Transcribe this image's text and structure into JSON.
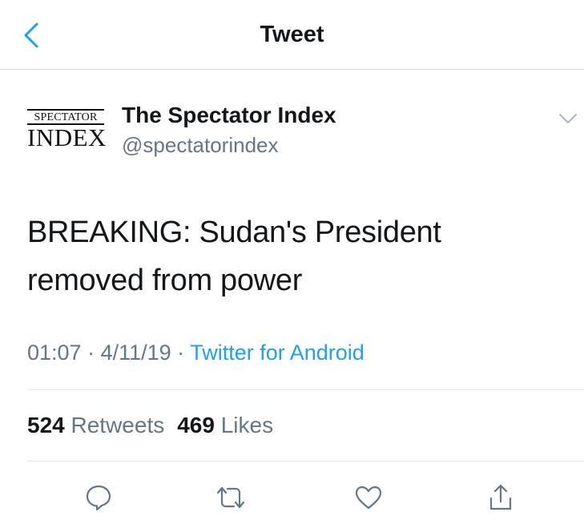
{
  "nav": {
    "title": "Tweet",
    "back_icon": "chevron-left-icon",
    "accent_color": "#1da1f2"
  },
  "author": {
    "logo_top": "SPECTATOR",
    "logo_bottom": "INDEX",
    "display_name": "The Spectator Index",
    "handle": "@spectatorindex",
    "menu_icon": "chevron-down-icon"
  },
  "tweet": {
    "text": "BREAKING: Sudan's President removed from power",
    "time": "01:07",
    "separator": " · ",
    "date": "4/11/19",
    "source": "Twitter for Android"
  },
  "stats": {
    "retweets_count": "524",
    "retweets_label": "Retweets",
    "likes_count": "469",
    "likes_label": "Likes"
  },
  "actions": [
    {
      "icon": "reply-icon"
    },
    {
      "icon": "retweet-icon"
    },
    {
      "icon": "like-icon"
    },
    {
      "icon": "share-icon"
    }
  ],
  "colors": {
    "text_primary": "#14171a",
    "text_secondary": "#657786",
    "link": "#1da1f2",
    "divider": "#e1e4e6"
  }
}
